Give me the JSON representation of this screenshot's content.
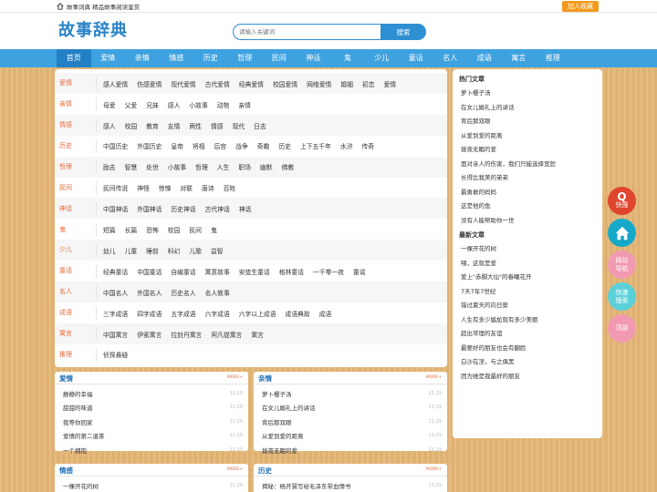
{
  "topbar": {
    "home_text": "故事词典 精品故事阅读鉴赏",
    "favorite": "加入收藏"
  },
  "header": {
    "logo": "故事辞典",
    "search_placeholder": "请输入关键词",
    "search_button": "搜索"
  },
  "nav": [
    "首页",
    "爱情",
    "亲情",
    "情感",
    "历史",
    "哲理",
    "民间",
    "神话",
    "鬼",
    "少儿",
    "童话",
    "名人",
    "成语",
    "寓言",
    "推理"
  ],
  "categories": [
    {
      "name": "爱情",
      "links": [
        "感人爱情",
        "伤感爱情",
        "现代爱情",
        "古代爱情",
        "经典爱情",
        "校园爱情",
        "网络爱情",
        "婚姻",
        "初恋",
        "爱情"
      ]
    },
    {
      "name": "亲情",
      "links": [
        "母爱",
        "父爱",
        "兄妹",
        "感人",
        "小故事",
        "动物",
        "亲情"
      ]
    },
    {
      "name": "情感",
      "links": [
        "感人",
        "校园",
        "教育",
        "友情",
        "两性",
        "情感",
        "现代",
        "日志"
      ]
    },
    {
      "name": "历史",
      "links": [
        "中国历史",
        "外国历史",
        "皇帝",
        "将相",
        "后宫",
        "战争",
        "奇趣",
        "历史",
        "上下五千年",
        "水浒",
        "传奇"
      ]
    },
    {
      "name": "哲理",
      "links": [
        "励志",
        "智慧",
        "处世",
        "小故事",
        "哲理",
        "人生",
        "职场",
        "幽默",
        "佛教"
      ]
    },
    {
      "name": "民间",
      "links": [
        "民间传说",
        "神怪",
        "惊悚",
        "对联",
        "唐诗",
        "百姓"
      ]
    },
    {
      "name": "神话",
      "links": [
        "中国神话",
        "外国神话",
        "历史神话",
        "古代神话",
        "神话"
      ]
    },
    {
      "name": "鬼",
      "links": [
        "短篇",
        "长篇",
        "恐怖",
        "校园",
        "民间",
        "鬼"
      ]
    },
    {
      "name": "少儿",
      "links": [
        "幼儿",
        "儿童",
        "睡前",
        "科幻",
        "儿歌",
        "益智"
      ]
    },
    {
      "name": "童话",
      "links": [
        "经典童话",
        "中国童话",
        "自编童话",
        "寓意故事",
        "安徒生童话",
        "格林童话",
        "一千零一夜",
        "童谣"
      ]
    },
    {
      "name": "名人",
      "links": [
        "中国名人",
        "外国名人",
        "历史名人",
        "名人轶事"
      ]
    },
    {
      "name": "成语",
      "links": [
        "三字成语",
        "四字成语",
        "五字成语",
        "六字成语",
        "六字以上成语",
        "成语典故",
        "成语"
      ]
    },
    {
      "name": "寓言",
      "links": [
        "中国寓言",
        "伊索寓言",
        "拉封丹寓言",
        "阿凡提寓言",
        "寓言"
      ]
    },
    {
      "name": "推理",
      "links": [
        "侦探悬疑"
      ]
    }
  ],
  "sidebar": {
    "hot_title": "热门文章",
    "hot": [
      "萝卜樱子汤",
      "在女儿婚礼上的讲话",
      "背后那双眼",
      "从爱到爱的距离",
      "拨夜无眠的爱",
      "面对亲人的伤害，我们只能选择宽恕",
      "长得比我美的弟弟",
      "最勇敢的妈妈",
      "这是他的鱼",
      "没有人能帮助你一世"
    ],
    "new_title": "最新文章",
    "new": [
      "一棵开花的树",
      "喂，这就是爱",
      "爱上\"赤脚大仙\"的春曦花开",
      "7天7年7世纪",
      "错过夏天的向日葵",
      "人生有多少尴尬就有多少美丽",
      "超出常理的友谊",
      "最要好的朋友也会有翻脸",
      "白沙在涅，与之俱黑",
      "因为她是我最好的朋友"
    ]
  },
  "panels": [
    {
      "title": "爱情",
      "more": "MORE+",
      "items": [
        "静静的幸福",
        "甜甜的味道",
        "我等你回家",
        "爱情的第二道茶",
        "一个拥抱"
      ],
      "date": "11-29"
    },
    {
      "title": "亲情",
      "more": "MORE+",
      "items": [
        "萝卜樱子汤",
        "在女儿婚礼上的讲话",
        "背后那双眼",
        "从爱到爱的距离",
        "拨夜无眠的爱"
      ],
      "date": "11-29"
    },
    {
      "title": "情感",
      "more": "MORE+",
      "items": [
        "一棵开花的树"
      ],
      "date": "11-29"
    },
    {
      "title": "历史",
      "more": "MORE+",
      "items": [
        "揭秘：杨开慧写给毛泽东带血情书"
      ],
      "date": "11-29"
    }
  ],
  "float_buttons": [
    {
      "label": "快搜",
      "icon": "q-search-icon",
      "color": "#e0452e"
    },
    {
      "label": "",
      "icon": "home-icon",
      "color": "#17a9c9"
    },
    {
      "label": "网站导航",
      "icon": "",
      "color": "#f29ab1"
    },
    {
      "label": "快速搜索",
      "icon": "",
      "color": "#5cd0d9"
    },
    {
      "label": "顶部",
      "icon": "",
      "color": "#f29ab1"
    }
  ]
}
